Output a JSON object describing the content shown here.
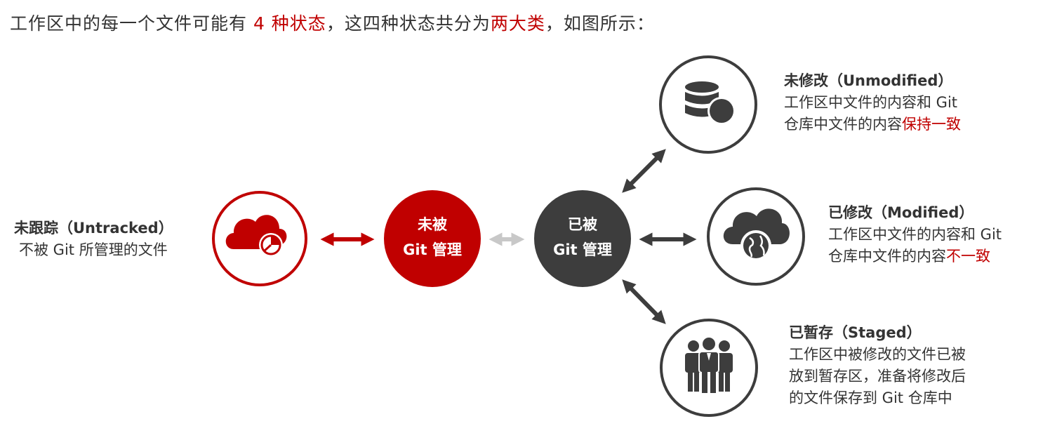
{
  "headline": {
    "part1": "工作区中的每一个文件可能有 ",
    "highlight1": "4 种状态",
    "part2": "，这四种状态共分为",
    "highlight2": "两大类",
    "part3": "，如图所示："
  },
  "colors": {
    "brand_red": "#c00000",
    "dark_gray": "#3d3d3d",
    "light_gray": "#c8c8c8",
    "text": "#333333"
  },
  "nodes": {
    "untracked_icon": "cloud-pie-chart-icon",
    "unmanaged": {
      "line1": "未被",
      "line2": "Git 管理"
    },
    "managed": {
      "line1": "已被",
      "line2": "Git 管理"
    },
    "unmodified_icon": "database-icon",
    "modified_icon": "cloud-globe-icon",
    "staged_icon": "people-group-icon"
  },
  "untracked": {
    "title": "未跟踪（Untracked）",
    "line1": "不被 Git 所管理的文件"
  },
  "unmodified": {
    "title": "未修改（Unmodified）",
    "line1": "工作区中文件的内容和 Git",
    "line2_plain": "仓库中文件的内容",
    "line2_red": "保持一致"
  },
  "modified": {
    "title": "已修改（Modified）",
    "line1": "工作区中文件的内容和 Git",
    "line2_plain": "仓库中文件的内容",
    "line2_red": "不一致"
  },
  "staged": {
    "title": "已暂存（Staged）",
    "line1": "工作区中被修改的文件已被",
    "line2": "放到暂存区，准备将修改后",
    "line3": "的文件保存到 Git 仓库中"
  }
}
